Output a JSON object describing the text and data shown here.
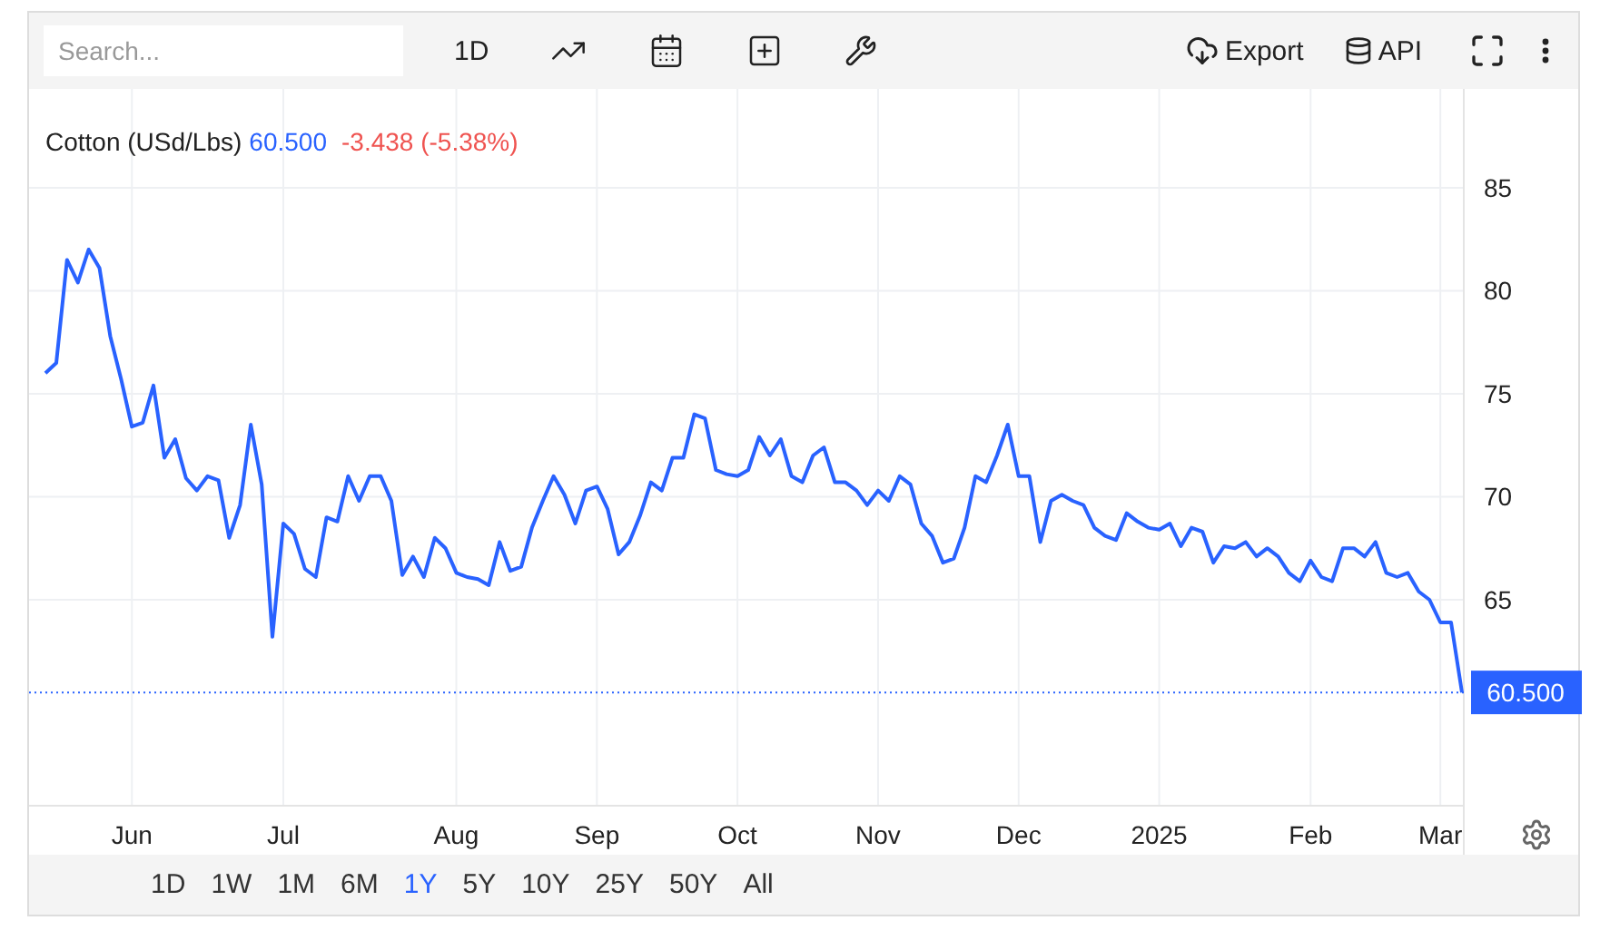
{
  "toolbar": {
    "search": {
      "placeholder": "Search..."
    },
    "interval": "1D",
    "export": "Export",
    "api": "API"
  },
  "legend": {
    "price": "60.500",
    "change": "-3.438 (-5.38%)"
  },
  "price_label": "60.500",
  "chart_data": {
    "type": "line",
    "grid": true,
    "ref_lines": [
      {
        "axis": "y",
        "value": 60.5
      }
    ],
    "ylim": [
      55,
      89.8
    ],
    "yticks": [
      65,
      70,
      75,
      80,
      85
    ],
    "categories": [
      null,
      null,
      null,
      null,
      null,
      null,
      null,
      null,
      "Jun",
      null,
      null,
      null,
      null,
      null,
      null,
      null,
      null,
      null,
      null,
      null,
      null,
      null,
      "Jul",
      null,
      null,
      null,
      null,
      null,
      null,
      null,
      null,
      null,
      null,
      null,
      null,
      null,
      null,
      null,
      "Aug",
      null,
      null,
      null,
      null,
      null,
      null,
      null,
      null,
      null,
      null,
      null,
      null,
      "Sep",
      null,
      null,
      null,
      null,
      null,
      null,
      null,
      null,
      null,
      null,
      null,
      null,
      "Oct",
      null,
      null,
      null,
      null,
      null,
      null,
      null,
      null,
      null,
      null,
      null,
      null,
      "Nov",
      null,
      null,
      null,
      null,
      null,
      null,
      null,
      null,
      null,
      null,
      null,
      null,
      "Dec",
      null,
      null,
      null,
      null,
      null,
      null,
      null,
      null,
      null,
      null,
      null,
      null,
      "2025",
      null,
      null,
      null,
      null,
      null,
      null,
      null,
      null,
      null,
      null,
      null,
      null,
      null,
      "Feb",
      null,
      null,
      null,
      null,
      null,
      null,
      null,
      null,
      null,
      null,
      null,
      "Mar",
      null,
      null
    ],
    "series": [
      {
        "name": "Cotton (USd/Lbs)",
        "color": "#2962ff",
        "values": [
          76.0,
          76.5,
          81.5,
          80.4,
          82.0,
          81.1,
          77.8,
          75.7,
          73.4,
          73.6,
          75.4,
          71.9,
          72.8,
          70.9,
          70.3,
          71.0,
          70.8,
          68.0,
          69.6,
          73.5,
          70.6,
          63.2,
          68.7,
          68.2,
          66.5,
          66.1,
          69.0,
          68.8,
          71.0,
          69.8,
          71.0,
          71.0,
          69.8,
          66.2,
          67.1,
          66.1,
          68.0,
          67.5,
          66.3,
          66.1,
          66.0,
          65.7,
          67.8,
          66.4,
          66.6,
          68.5,
          69.8,
          71.0,
          70.1,
          68.7,
          70.3,
          70.5,
          69.4,
          67.2,
          67.8,
          69.1,
          70.7,
          70.3,
          71.9,
          71.9,
          74.0,
          73.8,
          71.3,
          71.1,
          71.0,
          71.3,
          72.9,
          72.0,
          72.8,
          71.0,
          70.7,
          72.0,
          72.4,
          70.7,
          70.7,
          70.3,
          69.6,
          70.3,
          69.8,
          71.0,
          70.6,
          68.7,
          68.1,
          66.8,
          67.0,
          68.5,
          71.0,
          70.7,
          72.0,
          73.5,
          71.0,
          71.0,
          67.8,
          69.8,
          70.1,
          69.8,
          69.6,
          68.5,
          68.1,
          67.9,
          69.2,
          68.8,
          68.5,
          68.4,
          68.7,
          67.6,
          68.5,
          68.3,
          66.8,
          67.6,
          67.5,
          67.8,
          67.1,
          67.5,
          67.1,
          66.3,
          65.9,
          66.9,
          66.1,
          65.9,
          67.5,
          67.5,
          67.1,
          67.8,
          66.3,
          66.1,
          66.3,
          65.4,
          65.0,
          63.9,
          63.9,
          60.5
        ]
      }
    ]
  },
  "ranges": [
    {
      "label": "1D",
      "selected": false
    },
    {
      "label": "1W",
      "selected": false
    },
    {
      "label": "1M",
      "selected": false
    },
    {
      "label": "6M",
      "selected": false
    },
    {
      "label": "1Y",
      "selected": true
    },
    {
      "label": "5Y",
      "selected": false
    },
    {
      "label": "10Y",
      "selected": false
    },
    {
      "label": "25Y",
      "selected": false
    },
    {
      "label": "50Y",
      "selected": false
    },
    {
      "label": "All",
      "selected": false
    }
  ]
}
